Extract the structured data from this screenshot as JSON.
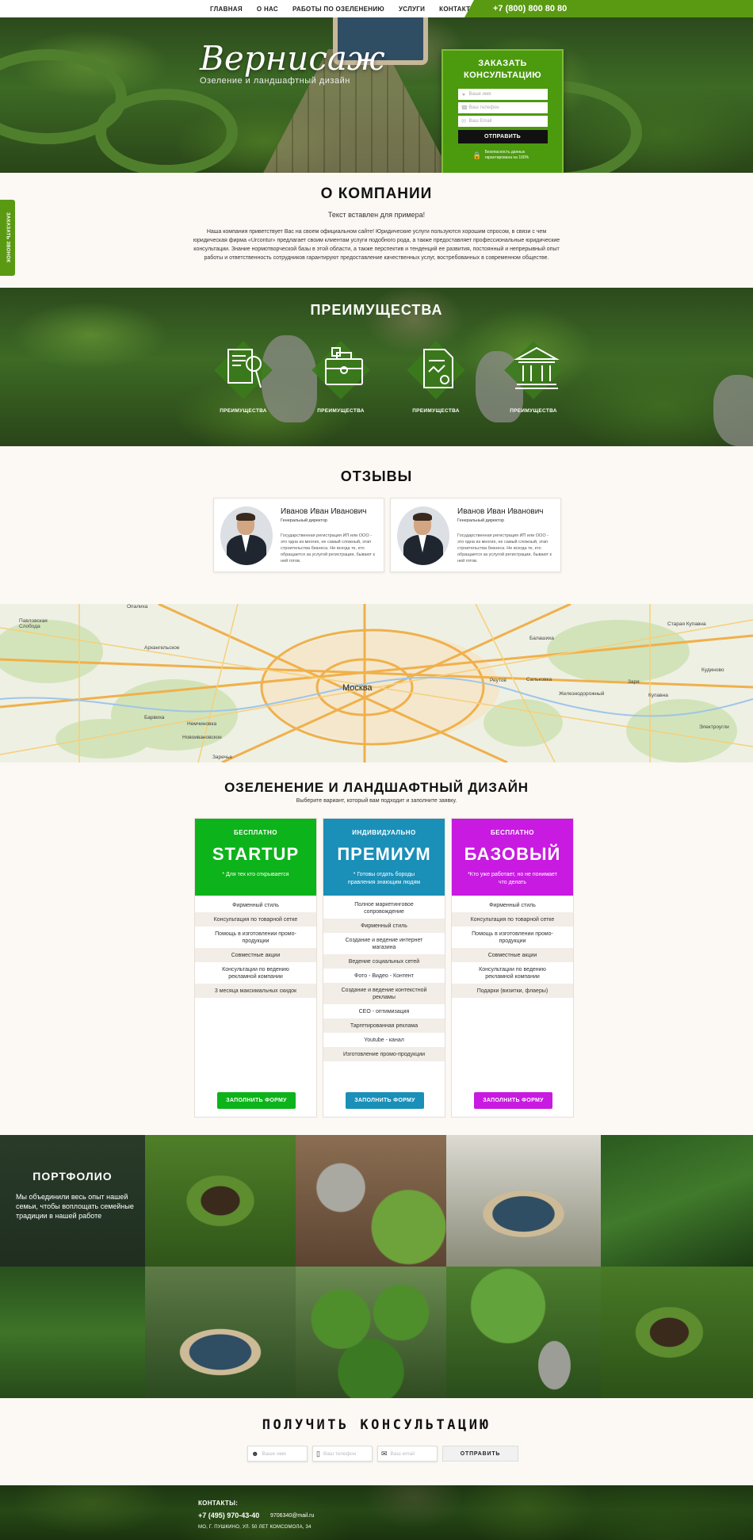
{
  "nav": {
    "items": [
      "ГЛАВНАЯ",
      "О НАС",
      "РАБОТЫ ПО ОЗЕЛЕНЕНИЮ",
      "УСЛУГИ",
      "КОНТАКТЫ"
    ],
    "phone": "+7 (800) 800 80 80"
  },
  "hero": {
    "logo": "Вернисаж",
    "tagline": "Озеление и ландшафтный дизайн",
    "form": {
      "title": "ЗАКАЗАТЬ КОНСУЛЬТАЦИЮ",
      "name_placeholder": "Ваше имя",
      "phone_placeholder": "Ваш телефон",
      "email_placeholder": "Ваш Email",
      "button": "ОТПРАВИТЬ",
      "security": "Безопасность данных гарантирована на 100%"
    }
  },
  "side_tab": "ЗАКАЗАТЬ ЗВОНОК",
  "about": {
    "title": "О КОМПАНИИ",
    "lead": "Текст вставлен для примера!",
    "body": "Наша компания приветствует Вас на своем официальном сайте! Юридические услуги пользуются  хорошим спросом, в связи с чем юридическая фирма «Urcontur» предлагает своим клиентам услуги подобного рода, а также предоставляет профессиональные юридические консультации. Знание нормотворческой базы в этой области, а также перспектив и тенденций ее развития, постоянный и непрерывный опыт работы и ответственность сотрудников гарантируют предоставление качественных услуг, востребованных в современном обществе."
  },
  "advantages": {
    "title": "ПРЕИМУЩЕСТВА",
    "items": [
      {
        "icon": "document-search-icon",
        "label": "ПРЕИМУЩЕСТВА"
      },
      {
        "icon": "briefcase-icon",
        "label": "ПРЕИМУЩЕСТВА"
      },
      {
        "icon": "certificate-icon",
        "label": "ПРЕИМУЩЕСТВА"
      },
      {
        "icon": "bank-icon",
        "label": "ПРЕИМУЩЕСТВА"
      }
    ]
  },
  "reviews": {
    "title": "ОТЗЫВЫ",
    "items": [
      {
        "name": "Иванов Иван Иванович",
        "role": "Генеральный директор",
        "text": "Государственная регистрация ИП или ООО - это одна из многих, не самый сложный, этап строительства бизнеса. Не всегда те, кто обращается за услугой регистрации, бывают к ней готов."
      },
      {
        "name": "Иванов Иван Иванович",
        "role": "Генеральный директор",
        "text": "Государственная регистрация ИП или ООО - это одна из многих, не самый сложный, этап строительства бизнеса. Не всегда те, кто обращается за услугой регистрации, бывают к ней готов."
      }
    ]
  },
  "map": {
    "labels": [
      "Москва",
      "Опалиха",
      "Павловская Слобода",
      "Архангельское",
      "Балашиха",
      "Старая Купавна",
      "Реутов",
      "Железнодорожный",
      "Кудиново",
      "Электроугли",
      "Заря",
      "Купавна",
      "Немчиновка",
      "Новоивановское",
      "Барвиха",
      "Заречье",
      "Сальковка"
    ]
  },
  "pricing": {
    "title": "ОЗЕЛЕНЕНИЕ И ЛАНДШАФТНЫЙ ДИЗАЙН",
    "subtitle": "Выберите вариант, который вам подходит и заполните заявку.",
    "plans": [
      {
        "tag": "БЕСПЛАТНО",
        "title": "STARTUP",
        "note": "* Для тех кто открывается",
        "color": "#0db31a",
        "features": [
          "Фирменный стиль",
          "Консультация по товарной сетке",
          "Помощь в изготовлении промо-продукции",
          "Совместные акции",
          "Консультации по ведению рекламной компании",
          "3 месяца максимальных скидок"
        ],
        "button": "ЗАПОЛНИТЬ ФОРМУ"
      },
      {
        "tag": "ИНДИВИДУАЛЬНО",
        "title": "ПРЕМИУМ",
        "note": "* Готовы отдать бороды правления знающим людям",
        "color": "#1a8fb8",
        "features": [
          "Полное маркетинговое сопровождение",
          "Фирменный стиль",
          "Создание и ведение интернет магазина",
          "Ведение социальных сетей",
          "Фото - Видео - Контент",
          "Создание и ведение контекстной рекламы",
          "СЕО - оптимизация",
          "Таргетированная реклама",
          "Youtube - канал",
          "Изготовление промо-продукции"
        ],
        "button": "ЗАПОЛНИТЬ ФОРМУ"
      },
      {
        "tag": "БЕСПЛАТНО",
        "title": "БАЗОВЫЙ",
        "note": "*Кто уже работает, но не понимает что делать",
        "color": "#c81ae0",
        "features": [
          "Фирменный стиль",
          "Консультация по товарной сетке",
          "Помощь в изготовлении промо-продукции",
          "Совместные акции",
          "Консультации по ведению рекламной компании",
          "Подарки (визитки, флаеры)"
        ],
        "button": "ЗАПОЛНИТЬ ФОРМУ"
      }
    ]
  },
  "portfolio": {
    "title": "ПОРТФОЛИО",
    "text": "Мы объединили весь опыт нашей семьи, чтобы воплощать семейные традиции в нашей работе"
  },
  "consult": {
    "title": "ПОЛУЧИТЬ КОНСУЛЬТАЦИЮ",
    "name_placeholder": "Ваше имя",
    "phone_placeholder": "Ваш телефон",
    "email_placeholder": "Ваш email",
    "button": "ОТПРАВИТЬ"
  },
  "footer": {
    "title": "КОНТАКТЫ:",
    "phone": "+7 (495) 970-43-40",
    "email": "9706340@mail.ru",
    "address": "МО, Г. ПУШКИНО, УЛ. 50 ЛЕТ КОМСОМОЛА, 34"
  }
}
